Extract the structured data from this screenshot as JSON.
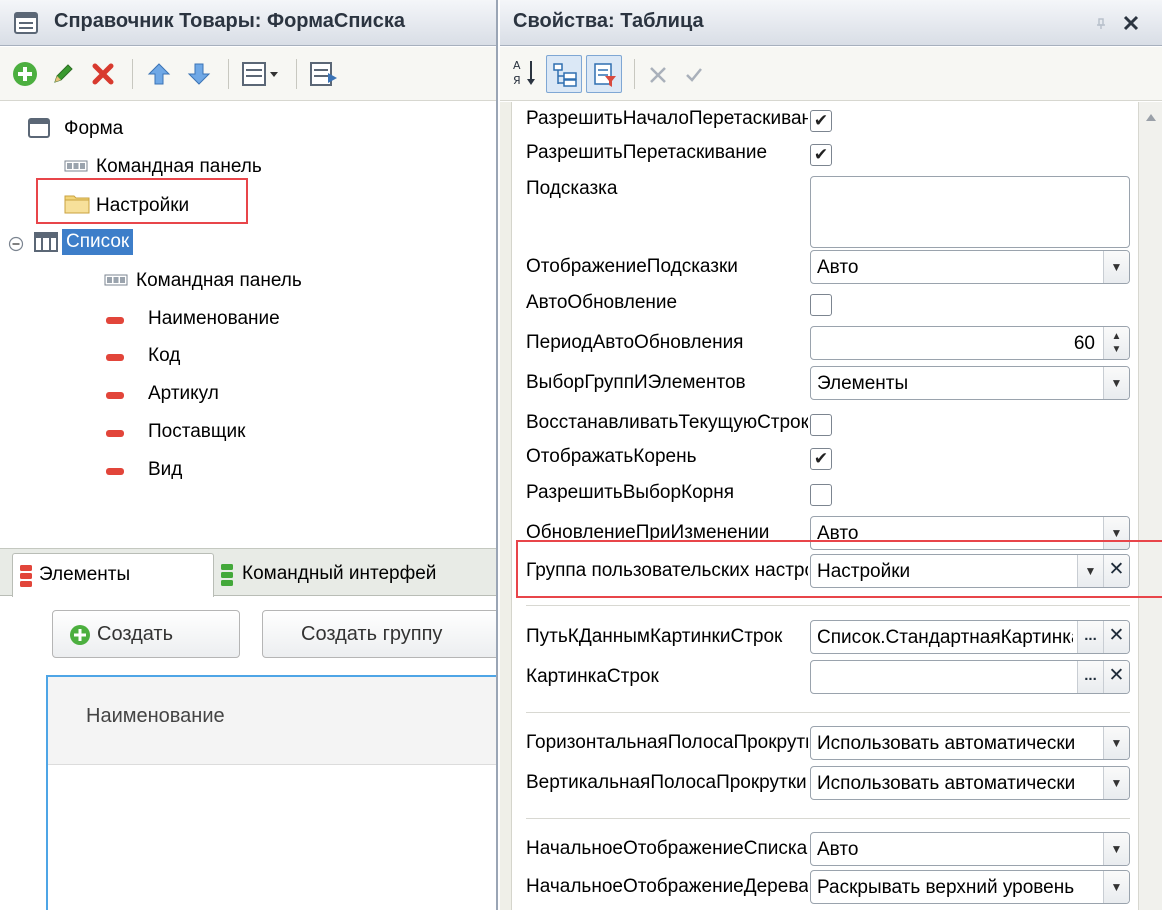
{
  "left_panel": {
    "title": "Справочник Товары: ФормаСписка",
    "tree": {
      "form": "Форма",
      "command_bar": "Командная панель",
      "settings": "Настройки",
      "list": "Список",
      "list_command_bar": "Командная панель",
      "fields": [
        "Наименование",
        "Код",
        "Артикул",
        "Поставщик",
        "Вид"
      ]
    },
    "tabs": {
      "elements": "Элементы",
      "command_interface": "Командный интерфей"
    },
    "preview": {
      "create_button": "Создать",
      "create_group_button": "Создать группу",
      "column_header": "Наименование"
    }
  },
  "right_panel": {
    "title": "Свойства: Таблица",
    "sort_label": "А Я",
    "properties": {
      "allow_drag_start": {
        "label": "РазрешитьНачалоПеретаскивания",
        "checked": true
      },
      "allow_drag": {
        "label": "РазрешитьПеретаскивание",
        "checked": true
      },
      "tooltip": {
        "label": "Подсказка",
        "value": ""
      },
      "tooltip_display": {
        "label": "ОтображениеПодсказки",
        "value": "Авто"
      },
      "auto_refresh": {
        "label": "АвтоОбновление",
        "checked": false
      },
      "auto_refresh_period": {
        "label": "ПериодАвтоОбновления",
        "value": "60"
      },
      "group_and_item_choice": {
        "label": "ВыборГруппИЭлементов",
        "value": "Элементы"
      },
      "restore_current": {
        "label": "ВосстанавливатьТекущуюСтроку",
        "checked": false
      },
      "show_root": {
        "label": "ОтображатьКорень",
        "checked": true
      },
      "allow_root_choice": {
        "label": "РазрешитьВыборКорня",
        "checked": false
      },
      "update_on_change": {
        "label": "ОбновлениеПриИзменении",
        "value": "Авто"
      },
      "user_settings_group": {
        "label": "Группа пользовательских настроек",
        "value": "Настройки"
      },
      "row_picture_data_path": {
        "label": "ПутьКДаннымКартинкиСтрок",
        "value": "Список.СтандартнаяКартинка"
      },
      "row_picture": {
        "label": "КартинкаСтрок",
        "value": ""
      },
      "horizontal_scrollbar": {
        "label": "ГоризонтальнаяПолосаПрокрутки",
        "value": "Использовать автоматически"
      },
      "vertical_scrollbar": {
        "label": "ВертикальнаяПолосаПрокрутки",
        "value": "Использовать автоматически"
      },
      "initial_list_view": {
        "label": "НачальноеОтображениеСписка",
        "value": "Авто"
      },
      "initial_tree_view": {
        "label": "НачальноеОтображениеДерева",
        "value": "Раскрывать верхний уровень"
      }
    },
    "checkmark": "✔",
    "dots": "...",
    "close": "✕"
  },
  "colors": {
    "highlight": "#e8454a",
    "selection": "#3d7ec9",
    "accent_blue": "#4ea5e6"
  }
}
